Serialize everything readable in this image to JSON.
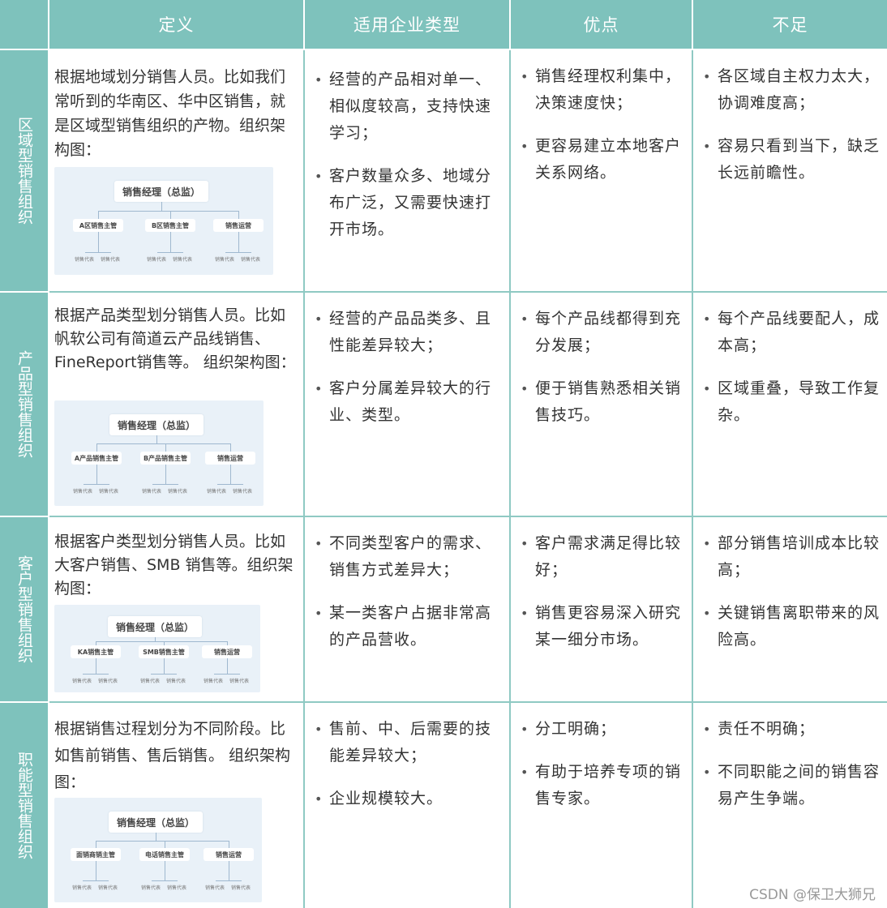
{
  "headers": [
    "",
    "定义",
    "适用企业类型",
    "优点",
    "不足"
  ],
  "rows": [
    {
      "label": "区域型销售组织",
      "definition": "根据地域划分销售人员。比如我们常听到的华南区、华中区销售，就是区域型销售组织的产物。组织架构图：",
      "org": {
        "top": "销售经理（总监）",
        "subs": [
          "A区销售主管",
          "B区销售主管",
          "销售运营"
        ],
        "leaf": "销售代表"
      },
      "types": [
        "经营的产品相对单一、相似度较高，支持快速学习；",
        "客户数量众多、地域分布广泛，又需要快速打开市场。"
      ],
      "pros": [
        "销售经理权利集中，决策速度快；",
        "更容易建立本地客户关系网络。"
      ],
      "cons": [
        "各区域自主权力太大，协调难度高；",
        "容易只看到当下，缺乏长远前瞻性。"
      ]
    },
    {
      "label": "产品型销售组织",
      "definition": "根据产品类型划分销售人员。比如帆软公司有简道云产品线销售、FineReport销售等。 组织架构图：",
      "org": {
        "top": "销售经理（总监）",
        "subs": [
          "A产品销售主管",
          "B产品销售主管",
          "销售运营"
        ],
        "leaf": "销售代表"
      },
      "types": [
        "经营的产品品类多、且性能差异较大；",
        "客户分属差异较大的行业、类型。"
      ],
      "pros": [
        "每个产品线都得到充分发展；",
        "便于销售熟悉相关销售技巧。"
      ],
      "cons": [
        "每个产品线要配人，成本高；",
        "区域重叠，导致工作复杂。"
      ]
    },
    {
      "label": "客户型销售组织",
      "definition": "根据客户类型划分销售人员。比如大客户销售、SMB 销售等。组织架构图：",
      "org": {
        "top": "销售经理（总监）",
        "subs": [
          "KA销售主管",
          "SMB销售主管",
          "销售运营"
        ],
        "leaf": "销售代表"
      },
      "types": [
        "不同类型客户的需求、销售方式差异大；",
        "某一类客户占据非常高的产品营收。"
      ],
      "pros": [
        "客户需求满足得比较好；",
        "销售更容易深入研究某一细分市场。"
      ],
      "cons": [
        "部分销售培训成本比较高；",
        "关键销售离职带来的风险高。"
      ]
    },
    {
      "label": "职能型销售组织",
      "definition": "根据销售过程划分为不同阶段。比如售前销售、售后销售。 组织架构图：",
      "org": {
        "top": "销售经理（总监）",
        "subs": [
          "面销商销主管",
          "电话销售主管",
          "销售运营"
        ],
        "leaf": "销售代表"
      },
      "types": [
        "售前、中、后需要的技能差异较大；",
        "企业规模较大。"
      ],
      "pros": [
        "分工明确；",
        "有助于培养专项的销售专家。"
      ],
      "cons": [
        "责任不明确；",
        "不同职能之间的销售容易产生争端。"
      ]
    }
  ],
  "watermark": "CSDN @保卫大狮兄",
  "colors": {
    "header_bg": "#7ec2bc",
    "grid_line": "#8fc9c3",
    "chart_bg": "#e9f1f8"
  }
}
